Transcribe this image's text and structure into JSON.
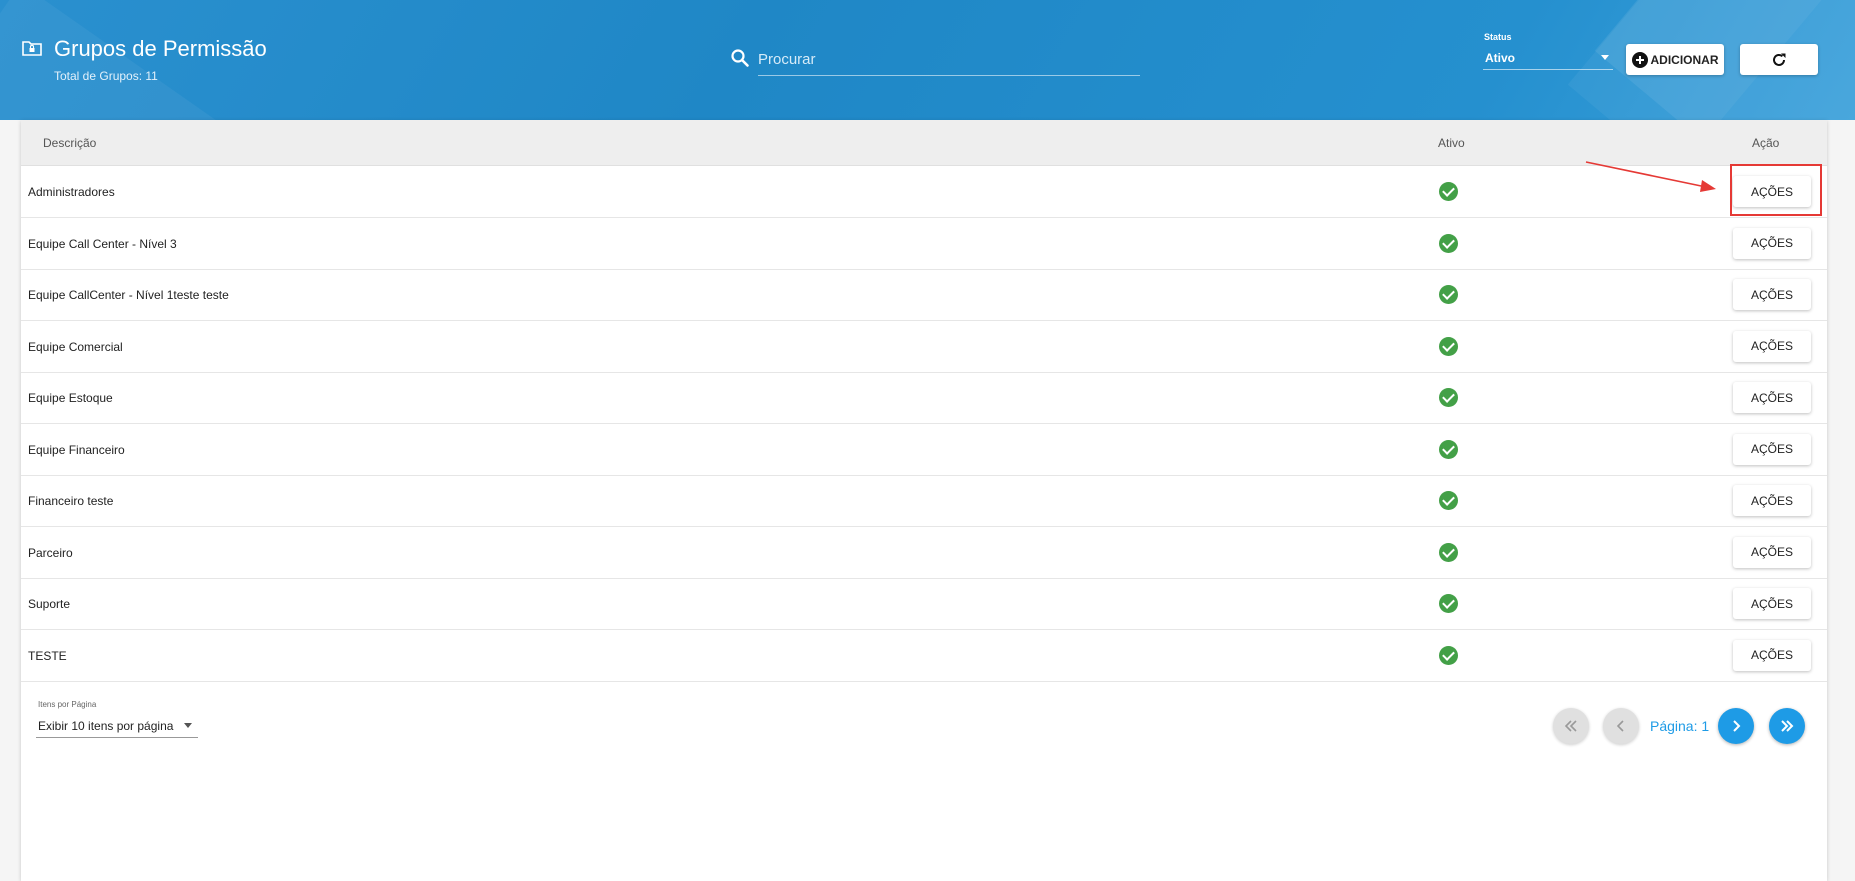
{
  "header": {
    "title": "Grupos de Permissão",
    "subtitle": "Total de Grupos: 11",
    "title_icon": "folder-lock-icon"
  },
  "search": {
    "placeholder": "Procurar",
    "value": ""
  },
  "status_filter": {
    "label": "Status",
    "value": "Ativo"
  },
  "toolbar": {
    "add_label": "ADICIONAR",
    "refresh_icon": "refresh-icon"
  },
  "table": {
    "columns": [
      "Descrição",
      "Ativo",
      "Ação"
    ],
    "action_label": "AÇÕES",
    "rows": [
      {
        "descricao": "Administradores",
        "ativo": true
      },
      {
        "descricao": "Equipe Call Center - Nível 3",
        "ativo": true
      },
      {
        "descricao": "Equipe CallCenter - Nível 1teste teste",
        "ativo": true
      },
      {
        "descricao": "Equipe Comercial",
        "ativo": true
      },
      {
        "descricao": "Equipe Estoque",
        "ativo": true
      },
      {
        "descricao": "Equipe Financeiro",
        "ativo": true
      },
      {
        "descricao": "Financeiro teste",
        "ativo": true
      },
      {
        "descricao": "Parceiro",
        "ativo": true
      },
      {
        "descricao": "Suporte",
        "ativo": true
      },
      {
        "descricao": "TESTE",
        "ativo": true
      }
    ]
  },
  "pagination": {
    "items_label": "Itens por Página",
    "items_value": "Exibir 10 itens por página",
    "page_label": "Página: 1"
  },
  "colors": {
    "header_blue": "#2590cf",
    "accent_blue": "#1e9be6",
    "check_green": "#43a047",
    "annotation_red": "#e53935"
  }
}
